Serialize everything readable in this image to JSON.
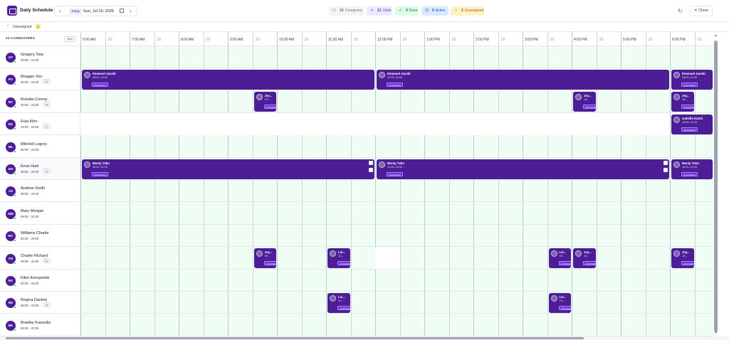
{
  "app": {
    "title": "Daily Schedule"
  },
  "datenav": {
    "prev_icon": "chevron-left-icon",
    "today_label": "Today",
    "date": "Sun, Jul 19, 2026",
    "calendar_icon": "calendar-icon",
    "next_icon": "chevron-right-icon"
  },
  "stats": {
    "caregivers": {
      "count": "24",
      "label": "Caregivers",
      "icon": "people-icon"
    },
    "visits": {
      "count": "21",
      "label": "Visits",
      "icon": "pulse-icon"
    },
    "done": {
      "count": "0",
      "label": "Done",
      "icon": "check-circle-icon"
    },
    "active": {
      "count": "0",
      "label": "Active",
      "icon": "clock-icon"
    },
    "unassigned": {
      "count": "2",
      "label": "Unassigned",
      "icon": "warning-circle-icon"
    }
  },
  "header_actions": {
    "refresh_icon": "refresh-icon",
    "close_label": "Close"
  },
  "unassigned_bar": {
    "label": "Unassigned",
    "count": "2"
  },
  "timeline": {
    "caregiver_count_label": "24 CAREGIVERS",
    "zoom_label": "30m",
    "ticks": [
      "6:00 AM",
      ":30",
      "7:00 AM",
      ":30",
      "8:00 AM",
      ":30",
      "9:00 AM",
      ":30",
      "10:00 AM",
      ":30",
      "11:00 AM",
      ":30",
      "12:00 PM",
      ":30",
      "1:00 PM",
      ":30",
      "2:00 PM",
      ":30",
      "3:00 PM",
      ":30",
      "4:00 PM",
      ":30",
      "5:00 PM",
      ":30",
      "6:00 PM",
      ":30"
    ]
  },
  "caregivers": [
    {
      "initials": "GT",
      "name": "Gregory Torp",
      "hours": "00:00 · 24:00",
      "visit_count": ""
    },
    {
      "initials": "RV",
      "name": "Reagan Von",
      "hours": "00:00 · 24:00",
      "visit_count": "3v"
    },
    {
      "initials": "RC",
      "name": "Rosalia Conroy",
      "hours": "00:00 · 24:00",
      "visit_count": "3v"
    },
    {
      "initials": "EK",
      "name": "Eula Kihn",
      "hours": "18:00 · 22:00",
      "visit_count": "1v"
    },
    {
      "initials": "ML",
      "name": "Mitchell Legros",
      "hours": "00:00 · 24:00",
      "visit_count": ""
    },
    {
      "initials": "EH",
      "name": "Enos Huel",
      "hours": "00:00 · 24:00",
      "visit_count": "3v"
    },
    {
      "initials": "AS",
      "name": "Andrew Smith",
      "hours": "00:00 · 24:00",
      "visit_count": ""
    },
    {
      "initials": "MM",
      "name": "Mary Morgan",
      "hours": "06:00 · 22:00",
      "visit_count": ""
    },
    {
      "initials": "WC",
      "name": "Williams Charlie",
      "hours": "00:00 · 24:00",
      "visit_count": ""
    },
    {
      "initials": "CR",
      "name": "Charlie Richard",
      "hours": "06:00 · 22:00",
      "visit_count": "6v"
    },
    {
      "initials": "EK",
      "name": "Elliot Konopelski",
      "hours": "00:00 · 24:00",
      "visit_count": ""
    },
    {
      "initials": "RD",
      "name": "Regina Daniels",
      "hours": "06:00 · 22:00",
      "visit_count": "3v"
    },
    {
      "initials": "BK",
      "name": "Bradley Kassulke",
      "hours": "06:00 · 22:00",
      "visit_count": ""
    }
  ],
  "visits": [
    {
      "row": 1,
      "start": "6:00 AM",
      "end": "12:00 PM",
      "client": "Emanuel Jacobi",
      "time": "06:00–12:00",
      "status": "Scheduled"
    },
    {
      "row": 1,
      "start": "12:00 PM",
      "end": "6:00 PM",
      "client": "Emanuel Jacobi",
      "time": "12:00–18:00",
      "status": "Scheduled"
    },
    {
      "row": 1,
      "start": "6:00 PM",
      "end": "10:00 PM",
      "client": "Emanuel Jacobi",
      "time": "18:00–22:00",
      "status": "Scheduled"
    },
    {
      "row": 2,
      "start": "9:30 AM",
      "end": "10:00 AM",
      "client": "Joy...",
      "time": "09:...",
      "status": "Scheduled"
    },
    {
      "row": 2,
      "start": "4:00 PM",
      "end": "4:30 PM",
      "client": "Joy...",
      "time": "16:...",
      "status": "Scheduled"
    },
    {
      "row": 2,
      "start": "6:00 PM",
      "end": "6:30 PM",
      "client": "Joy...",
      "time": "18:...",
      "status": "Scheduled"
    },
    {
      "row": 3,
      "start": "6:00 PM",
      "end": "10:00 PM",
      "client": "Isabella Kutch",
      "time": "18:00–22:00",
      "status": "Scheduled"
    },
    {
      "row": 5,
      "start": "6:00 AM",
      "end": "12:00 PM",
      "client": "Monty Yoko",
      "time": "06:00–12:00",
      "status": "Scheduled"
    },
    {
      "row": 5,
      "start": "12:00 PM",
      "end": "6:00 PM",
      "client": "Monty Yoko",
      "time": "12:00–18:00",
      "status": "Scheduled"
    },
    {
      "row": 5,
      "start": "6:00 PM",
      "end": "10:00 PM",
      "client": "Monty Yoko",
      "time": "18:00–22:00",
      "status": "Scheduled"
    },
    {
      "row": 9,
      "start": "9:30 AM",
      "end": "10:00 AM",
      "client": "Joy...",
      "time": "09:...",
      "status": "Scheduled"
    },
    {
      "row": 9,
      "start": "11:00 AM",
      "end": "11:30 AM",
      "client": "Lei...",
      "time": "11:...",
      "status": "Scheduled"
    },
    {
      "row": 9,
      "start": "3:30 PM",
      "end": "4:00 PM",
      "client": "Lei...",
      "time": "15:...",
      "status": "Scheduled"
    },
    {
      "row": 9,
      "start": "4:00 PM",
      "end": "4:30 PM",
      "client": "Joy...",
      "time": "16:...",
      "status": "Scheduled"
    },
    {
      "row": 9,
      "start": "6:00 PM",
      "end": "6:30 PM",
      "client": "Joy...",
      "time": "18:...",
      "status": "Scheduled"
    },
    {
      "row": 11,
      "start": "11:00 AM",
      "end": "11:30 AM",
      "client": "Lei...",
      "time": "11:...",
      "status": "Scheduled"
    },
    {
      "row": 11,
      "start": "3:30 PM",
      "end": "4:00 PM",
      "client": "Lei...",
      "time": "15:...",
      "status": "Scheduled"
    }
  ],
  "off_hours": [
    {
      "row": 3,
      "start": "6:00 AM",
      "end": "6:00 PM"
    },
    {
      "row": 9,
      "start": "12:00 PM",
      "end": "12:30 PM"
    }
  ]
}
